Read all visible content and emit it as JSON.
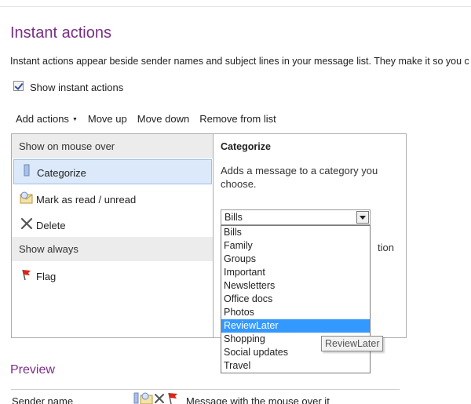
{
  "page": {
    "title": "Instant actions",
    "description": "Instant actions appear beside sender names and subject lines in your message list. They make it so you c"
  },
  "show_instant_actions": {
    "label": "Show instant actions",
    "checked": true
  },
  "toolbar": {
    "add_actions": "Add actions",
    "move_up": "Move up",
    "move_down": "Move down",
    "remove": "Remove from list"
  },
  "left_panel": {
    "mouse_over_header": "Show on mouse over",
    "always_header": "Show always",
    "actions": [
      {
        "label": "Categorize",
        "icon": "category-tag-icon",
        "selected": true
      },
      {
        "label": "Mark as read / unread",
        "icon": "envelope-read-icon",
        "selected": false
      },
      {
        "label": "Delete",
        "icon": "delete-x-icon",
        "selected": false
      },
      {
        "label": "Flag",
        "icon": "flag-icon",
        "selected": false
      }
    ]
  },
  "right_panel": {
    "title": "Categorize",
    "description": "Adds a message to a category you choose.",
    "partial_text_left": "(",
    "partial_text_right": "tion"
  },
  "category_select": {
    "value": "Bills",
    "options": [
      "Bills",
      "Family",
      "Groups",
      "Important",
      "Newsletters",
      "Office docs",
      "Photos",
      "ReviewLater",
      "Shopping",
      "Social updates",
      "Travel"
    ],
    "highlighted": "ReviewLater"
  },
  "tooltip": {
    "text": "ReviewLater"
  },
  "preview": {
    "title": "Preview",
    "sender_label": "Sender name",
    "message_text": "Message with the mouse over it"
  },
  "colors": {
    "heading": "#7a2d86",
    "selection_bg": "#dbe9fa",
    "highlight": "#3399ff"
  }
}
